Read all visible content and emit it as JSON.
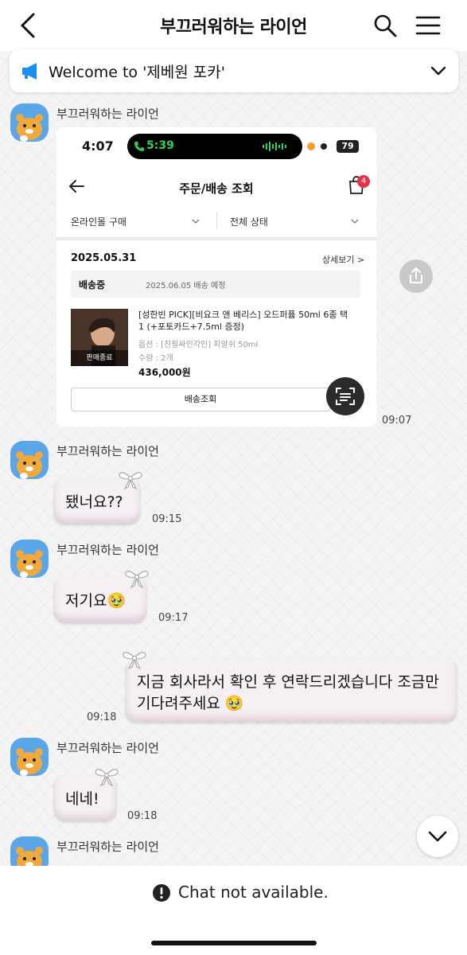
{
  "header": {
    "title": "부끄러워하는 라이언"
  },
  "notice": {
    "text": "Welcome to '제베원 포카'"
  },
  "messages": [
    {
      "sender": "부끄러워하는 라이언",
      "time": "09:07"
    },
    {
      "sender": "부끄러워하는 라이언",
      "text": "됐너요??",
      "time": "09:15"
    },
    {
      "sender": "부끄러워하는 라이언",
      "text": "저기요🥹",
      "time": "09:17"
    },
    {
      "sender": "me",
      "text_line1": "지금 회사라서 확인 후 연락드리겠습니다 조금만",
      "text_line2": "기다려주세요 🥹",
      "time": "09:18"
    },
    {
      "sender": "부끄러워하는 라이언",
      "text": "네네!",
      "time": "09:18"
    },
    {
      "sender": "부끄러워하는 라이언"
    }
  ],
  "screenshot": {
    "status_time": "4:07",
    "island_time": "5:39",
    "battery": "79",
    "title": "주문/배송 조회",
    "cart_count": "4",
    "filter1": "온라인몰 구매",
    "filter2": "전체 상태",
    "order_date": "2025.05.31",
    "detail_link": "상세보기 >",
    "ship_status": "배송중",
    "ship_eta": "2025.06.05 배송 예정",
    "thumb_label": "판매종료",
    "product_name": "[성한빈 PICK][비요크 앤 베리스] 오드퍼퓸 50ml 6종 택1 (+포토카드+7.5ml 증정)",
    "product_option": "옵션 : [친필싸인각인] 피알쉬 50ml",
    "product_qty": "수량 : 2개",
    "product_price": "436,000원",
    "track_button": "배송조회"
  },
  "footer": {
    "text": "Chat not available."
  },
  "colors": {
    "accent_blue": "#1e8ef0",
    "avatar_blue": "#5aa6e8",
    "lion_orange": "#f2a93b"
  }
}
